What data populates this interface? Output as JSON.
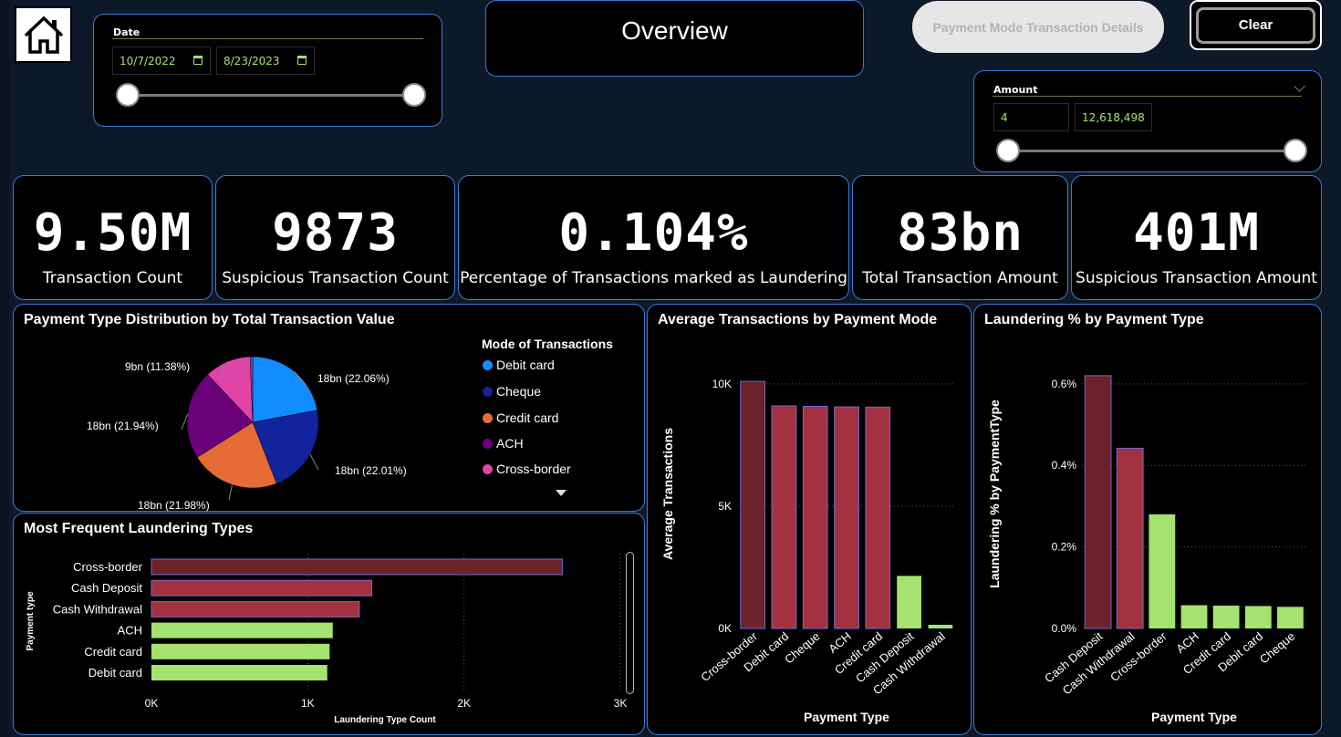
{
  "header": {
    "title": "Overview",
    "payment_mode_button": "Payment Mode Transaction Details",
    "clear_button": "Clear"
  },
  "date_slicer": {
    "label": "Date",
    "start": "10/7/2022",
    "end": "8/23/2023"
  },
  "amount_slicer": {
    "label": "Amount",
    "min": "4",
    "max": "12,618,498"
  },
  "kpis": [
    {
      "value": "9.50M",
      "label": "Transaction Count"
    },
    {
      "value": "9873",
      "label": "Suspicious Transaction Count"
    },
    {
      "value": "0.104%",
      "label": "Percentage of Transactions marked as Laundering"
    },
    {
      "value": "83bn",
      "label": "Total Transaction Amount"
    },
    {
      "value": "401M",
      "label": "Suspicious Transaction Amount"
    }
  ],
  "colors": {
    "accent_border": "#3a7bd5",
    "dark_red": "#6b2229",
    "red": "#a4313f",
    "green": "#a4e36f"
  },
  "chart_data": [
    {
      "type": "pie",
      "title": "Payment Type Distribution by Total Transaction Value",
      "legend_title": "Mode of Transactions",
      "legend_placement": "right",
      "slices": [
        {
          "name": "Debit card",
          "value": 22.06,
          "label": "18bn (22.06%)",
          "color": "#118dff"
        },
        {
          "name": "Cheque",
          "value": 22.01,
          "label": "18bn (22.01%)",
          "color": "#12239e"
        },
        {
          "name": "Credit card",
          "value": 21.98,
          "label": "18bn (21.98%)",
          "color": "#e66c37"
        },
        {
          "name": "ACH",
          "value": 21.94,
          "label": "18bn (21.94%)",
          "color": "#6b007b"
        },
        {
          "name": "Cross-border",
          "value": 11.38,
          "label": "9bn (11.38%)",
          "color": "#e044a7"
        },
        {
          "name": "",
          "value": 0.63,
          "label": "",
          "color": "#744ec2"
        }
      ]
    },
    {
      "type": "bar",
      "orientation": "horizontal",
      "title": "Most Frequent Laundering Types",
      "xlabel": "Laundering Type Count",
      "ylabel": "Payment type",
      "xlim": [
        0,
        3000
      ],
      "xticks": [
        "0K",
        "1K",
        "2K",
        "3K"
      ],
      "categories": [
        "Cross-border",
        "Cash Deposit",
        "Cash Withdrawal",
        "ACH",
        "Credit card",
        "Debit card"
      ],
      "values": [
        2630,
        1410,
        1330,
        1160,
        1140,
        1125
      ],
      "highlight": [
        "dark",
        "red",
        "red",
        "green",
        "green",
        "green"
      ]
    },
    {
      "type": "bar",
      "title": "Average Transactions by Payment Mode",
      "xlabel": "Payment Type",
      "ylabel": "Average Transactions",
      "ylim": [
        0,
        11000
      ],
      "yticks": [
        {
          "v": 0,
          "t": "0K"
        },
        {
          "v": 5000,
          "t": "5K"
        },
        {
          "v": 10000,
          "t": "10K"
        }
      ],
      "categories": [
        "Cross-border",
        "Debit card",
        "Cheque",
        "ACH",
        "Credit card",
        "Cash Deposit",
        "Cash Withdrawal"
      ],
      "values": [
        10100,
        9100,
        9080,
        9060,
        9050,
        2150,
        150
      ],
      "highlight": [
        "dark",
        "red",
        "red",
        "red",
        "red",
        "green",
        "green"
      ]
    },
    {
      "type": "bar",
      "title": "Laundering % by Payment Type",
      "xlabel": "Payment Type",
      "ylabel": "Laundering % by PaymentType",
      "ylim": [
        0,
        0.0066
      ],
      "yticks": [
        {
          "v": 0,
          "t": "0.0%"
        },
        {
          "v": 0.002,
          "t": "0.2%"
        },
        {
          "v": 0.004,
          "t": "0.4%"
        },
        {
          "v": 0.006,
          "t": "0.6%"
        }
      ],
      "categories": [
        "Cash Deposit",
        "Cash Withdrawal",
        "Cross-border",
        "ACH",
        "Credit card",
        "Debit card",
        "Cheque"
      ],
      "values": [
        0.0062,
        0.00442,
        0.0028,
        0.00057,
        0.00056,
        0.00055,
        0.00053
      ],
      "highlight": [
        "dark",
        "red",
        "green",
        "green",
        "green",
        "green",
        "green"
      ]
    }
  ]
}
